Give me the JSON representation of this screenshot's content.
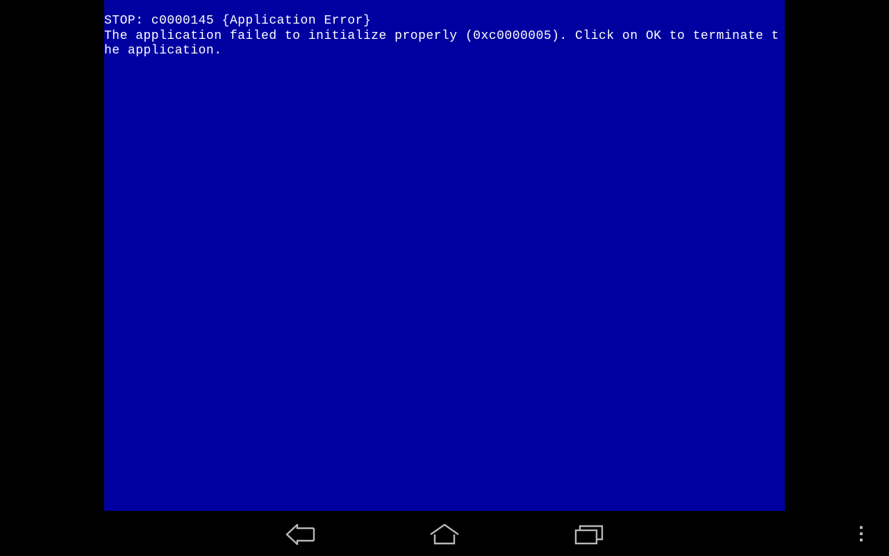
{
  "bsod": {
    "line1": "STOP: c0000145 {Application Error}",
    "line2": "The application failed to initialize properly (0xc0000005). Click on OK to terminate the application."
  },
  "nav": {
    "back": "back",
    "home": "home",
    "recents": "recent-apps",
    "overflow": "overflow-menu"
  },
  "colors": {
    "bsod_bg": "#0000A0",
    "text": "#ffffff",
    "frame": "#000000",
    "nav_icon": "#b8b8b8"
  }
}
